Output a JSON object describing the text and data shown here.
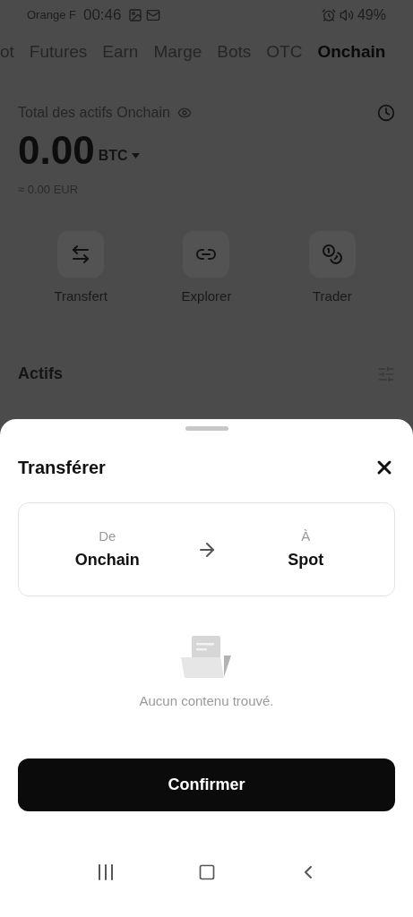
{
  "status_bar": {
    "carrier": "Orange F",
    "time": "00:46",
    "battery": "49%"
  },
  "tabs": [
    {
      "label": "ot",
      "selected": false
    },
    {
      "label": "Futures",
      "selected": false
    },
    {
      "label": "Earn",
      "selected": false
    },
    {
      "label": "Marge",
      "selected": false
    },
    {
      "label": "Bots",
      "selected": false
    },
    {
      "label": "OTC",
      "selected": false
    },
    {
      "label": "Onchain",
      "selected": true
    }
  ],
  "assets": {
    "label": "Total des actifs Onchain",
    "amount": "0.00",
    "currency": "BTC",
    "fiat": "≈ 0.00 EUR"
  },
  "actions": [
    {
      "kind": "transfer",
      "label": "Transfert"
    },
    {
      "kind": "link",
      "label": "Explorer"
    },
    {
      "kind": "coins",
      "label": "Trader"
    }
  ],
  "section_title": "Actifs",
  "sheet": {
    "title": "Transférer",
    "from_label": "De",
    "from_value": "Onchain",
    "to_label": "À",
    "to_value": "Spot",
    "empty_text": "Aucun contenu trouvé.",
    "confirm": "Confirmer"
  }
}
